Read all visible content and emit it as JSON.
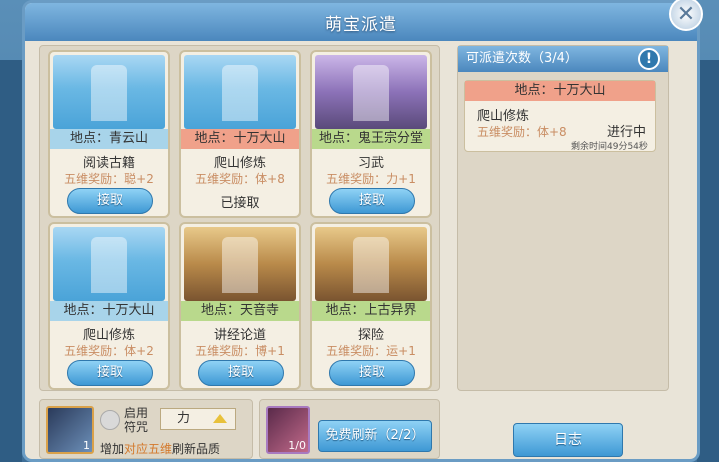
{
  "window": {
    "title": "萌宝派遣"
  },
  "cards": [
    {
      "location": "地点：青云山",
      "task": "阅读古籍",
      "reward": "五维奖励：聪+2",
      "button": "接取",
      "status": ""
    },
    {
      "location": "地点：十万大山",
      "task": "爬山修炼",
      "reward": "五维奖励：体+8",
      "button": "",
      "status": "已接取"
    },
    {
      "location": "地点：鬼王宗分堂",
      "task": "习武",
      "reward": "五维奖励：力+1",
      "button": "接取",
      "status": ""
    },
    {
      "location": "地点：十万大山",
      "task": "爬山修炼",
      "reward": "五维奖励：体+2",
      "button": "接取",
      "status": ""
    },
    {
      "location": "地点：天音寺",
      "task": "讲经论道",
      "reward": "五维奖励：博+1",
      "button": "接取",
      "status": ""
    },
    {
      "location": "地点：上古异界",
      "task": "探险",
      "reward": "五维奖励：运+1",
      "button": "接取",
      "status": ""
    }
  ],
  "charm": {
    "qty": "1",
    "enable_label": "启用符咒",
    "selected_attr": "力",
    "hint_prefix": "增加",
    "hint_highlight": "对应五维",
    "hint_suffix": "刷新品质"
  },
  "refresh": {
    "qty": "1/0",
    "button": "免费刷新（2/2）"
  },
  "dispatch": {
    "header": "可派遣次数（3/4）",
    "info": "!",
    "active": {
      "location": "地点：十万大山",
      "task": "爬山修炼",
      "reward": "五维奖励：体+8",
      "status": "进行中",
      "remaining": "剩余时间49分54秒"
    }
  },
  "log_button": "日志"
}
